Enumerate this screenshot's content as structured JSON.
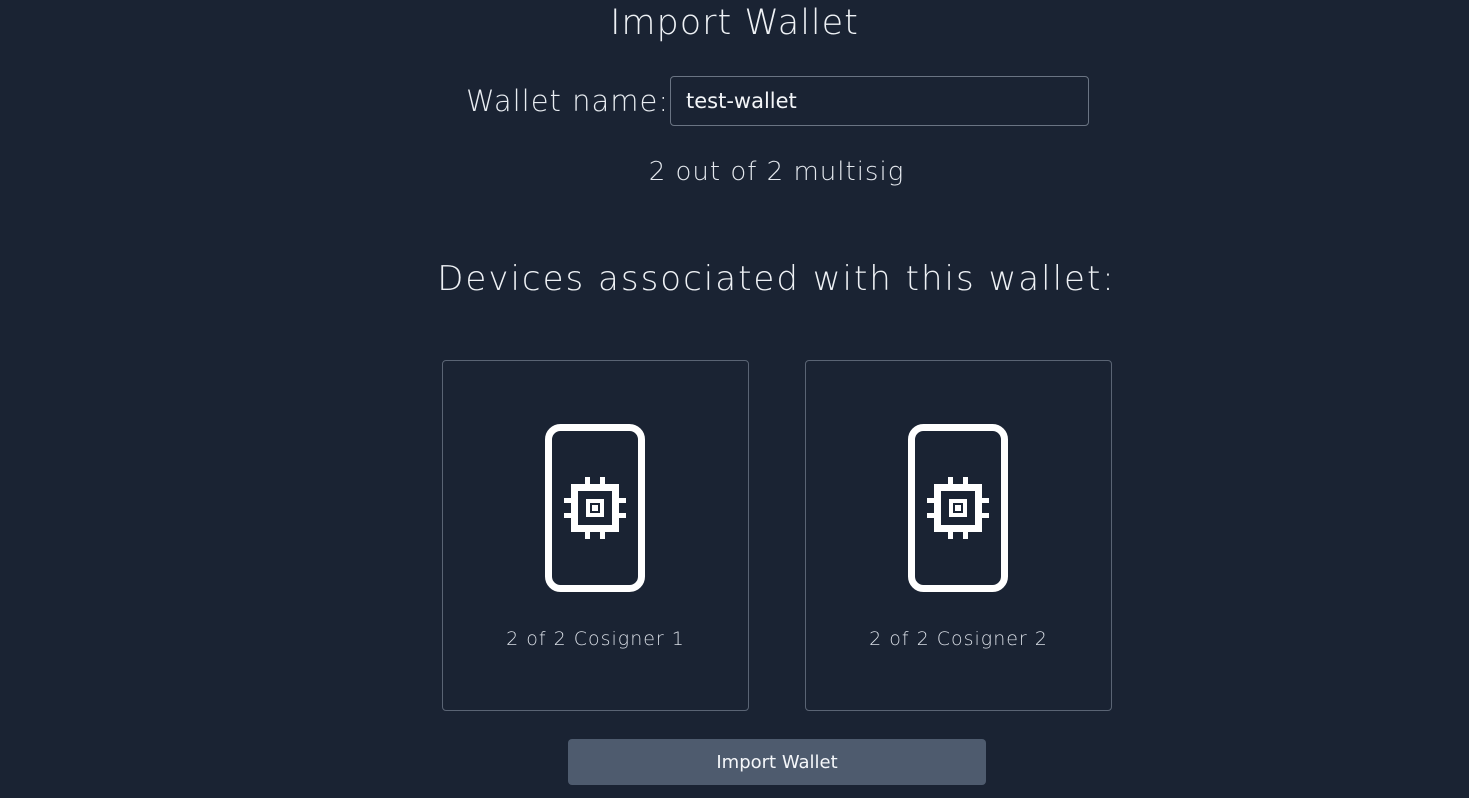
{
  "page": {
    "title": "Import Wallet"
  },
  "wallet_name": {
    "label": "Wallet name:",
    "value": "test-wallet"
  },
  "multisig": {
    "text": "2 out of 2 multisig"
  },
  "devices": {
    "heading": "Devices associated with this wallet:",
    "items": [
      {
        "label": "2 of 2 Cosigner 1",
        "icon": "hardware-device-chip-icon"
      },
      {
        "label": "2 of 2 Cosigner 2",
        "icon": "hardware-device-chip-icon"
      }
    ]
  },
  "actions": {
    "import_label": "Import Wallet"
  },
  "colors": {
    "background": "#1a2333",
    "text": "#eef1f5",
    "border": "#5a6474",
    "button": "#4e5b6e"
  }
}
